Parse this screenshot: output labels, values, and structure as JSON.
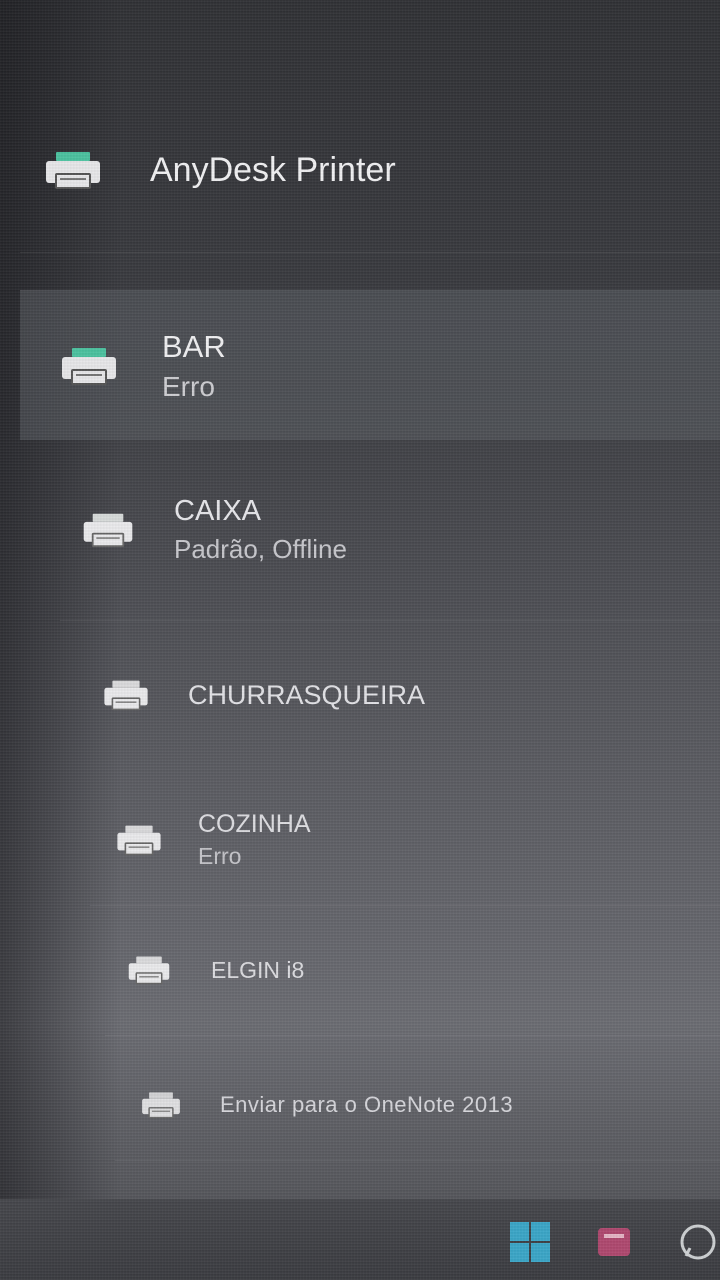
{
  "printers": [
    {
      "name": "AnyDesk Printer",
      "status": ""
    },
    {
      "name": "BAR",
      "status": "Erro"
    },
    {
      "name": "CAIXA",
      "status": "Padrão, Offline"
    },
    {
      "name": "CHURRASQUEIRA",
      "status": ""
    },
    {
      "name": "COZINHA",
      "status": "Erro"
    },
    {
      "name": "ELGIN i8",
      "status": ""
    },
    {
      "name": "Enviar para o OneNote 2013",
      "status": ""
    }
  ],
  "selected_printer": "BAR",
  "colors": {
    "icon_accent": "#3fbf9a",
    "icon_body": "#e8e8ea",
    "selected_row": "#5a5c62"
  },
  "icons": {
    "printer": "printer-icon",
    "start": "windows-start-icon",
    "app": "app-icon",
    "whatsapp": "whatsapp-icon"
  }
}
